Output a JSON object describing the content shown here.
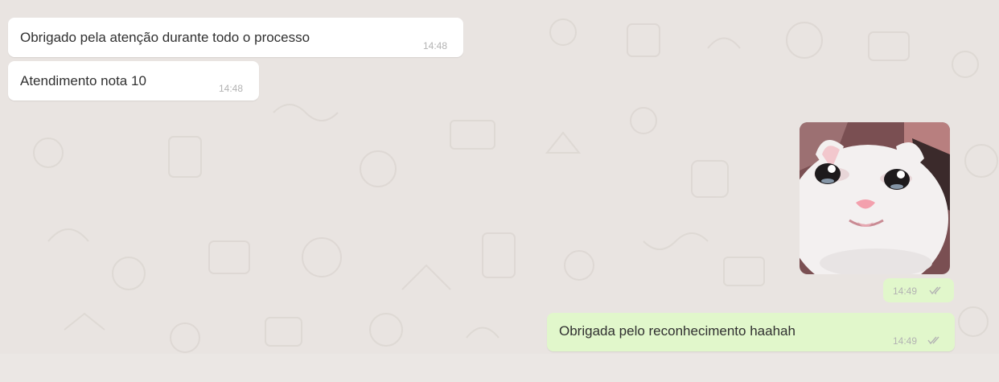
{
  "colors": {
    "chat_background": "#e9e4e1",
    "incoming_bubble": "#ffffff",
    "outgoing_bubble": "#e1f7cb",
    "time_text": "#b3b3b3",
    "read_ticks": "#b3b3b3"
  },
  "messages": [
    {
      "direction": "incoming",
      "text": "Obrigado pela atenção durante todo o processo",
      "time": "14:48"
    },
    {
      "direction": "incoming",
      "text": "Atendimento nota 10",
      "time": "14:48"
    },
    {
      "direction": "outgoing",
      "type": "sticker",
      "sticker": "crying-cat-sticker",
      "time": "14:49",
      "status": "read-double-check-icon"
    },
    {
      "direction": "outgoing",
      "text": "Obrigada pelo reconhecimento haahah",
      "time": "14:49",
      "status": "read-double-check-icon"
    }
  ]
}
